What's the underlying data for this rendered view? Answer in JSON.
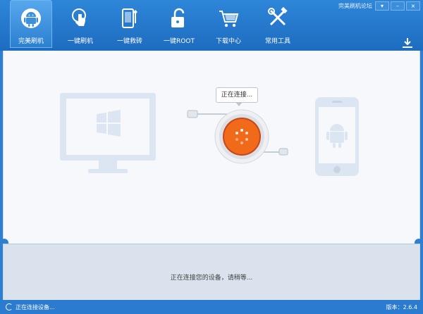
{
  "header": {
    "forum_link": "完美刷机论坛",
    "window_buttons": {
      "menu": "▾",
      "minimize": "–",
      "close": "×"
    },
    "nav": [
      {
        "label": "完美刷机",
        "icon": "android-icon",
        "active": true
      },
      {
        "label": "一键刷机",
        "icon": "touch-icon"
      },
      {
        "label": "一键救砖",
        "icon": "phone-wrench-icon"
      },
      {
        "label": "一键ROOT",
        "icon": "unlock-icon"
      },
      {
        "label": "下载中心",
        "icon": "cart-icon"
      },
      {
        "label": "常用工具",
        "icon": "tools-icon"
      }
    ]
  },
  "main": {
    "tooltip": "正在连接...",
    "status_message": "正在连接您的设备，请稍等..."
  },
  "statusbar": {
    "status_text": "正在连接设备...",
    "version": "版本：2.6.4"
  },
  "colors": {
    "header_blue": "#2e86d8",
    "accent_orange": "#f06a1a",
    "graphic_light": "#dbe6f2"
  }
}
